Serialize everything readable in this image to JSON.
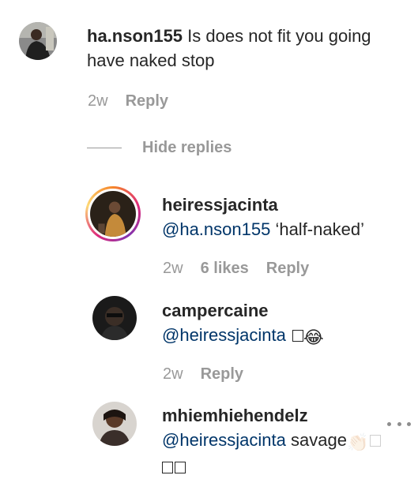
{
  "comments": [
    {
      "username": "ha.nson155",
      "text": "Is does not fit you going have naked stop",
      "time": "2w",
      "reply_label": "Reply"
    }
  ],
  "hide_replies_label": "Hide replies",
  "replies": [
    {
      "username": "heiressjacinta",
      "mention": "@ha.nson155",
      "text": "‘half-naked’",
      "time": "2w",
      "likes": "6 likes",
      "reply_label": "Reply",
      "has_story_ring": true
    },
    {
      "username": "campercaine",
      "mention": "@heiressjacinta",
      "text": "",
      "emoji": "😂",
      "time": "2w",
      "reply_label": "Reply"
    },
    {
      "username": "mhiemhiehendelz",
      "mention": "@heiressjacinta",
      "text": "savage",
      "emoji": "👏🏻"
    }
  ],
  "icons": {
    "more": "more-options-icon"
  },
  "colors": {
    "mention": "#003569",
    "meta": "#999999",
    "text": "#262626"
  }
}
